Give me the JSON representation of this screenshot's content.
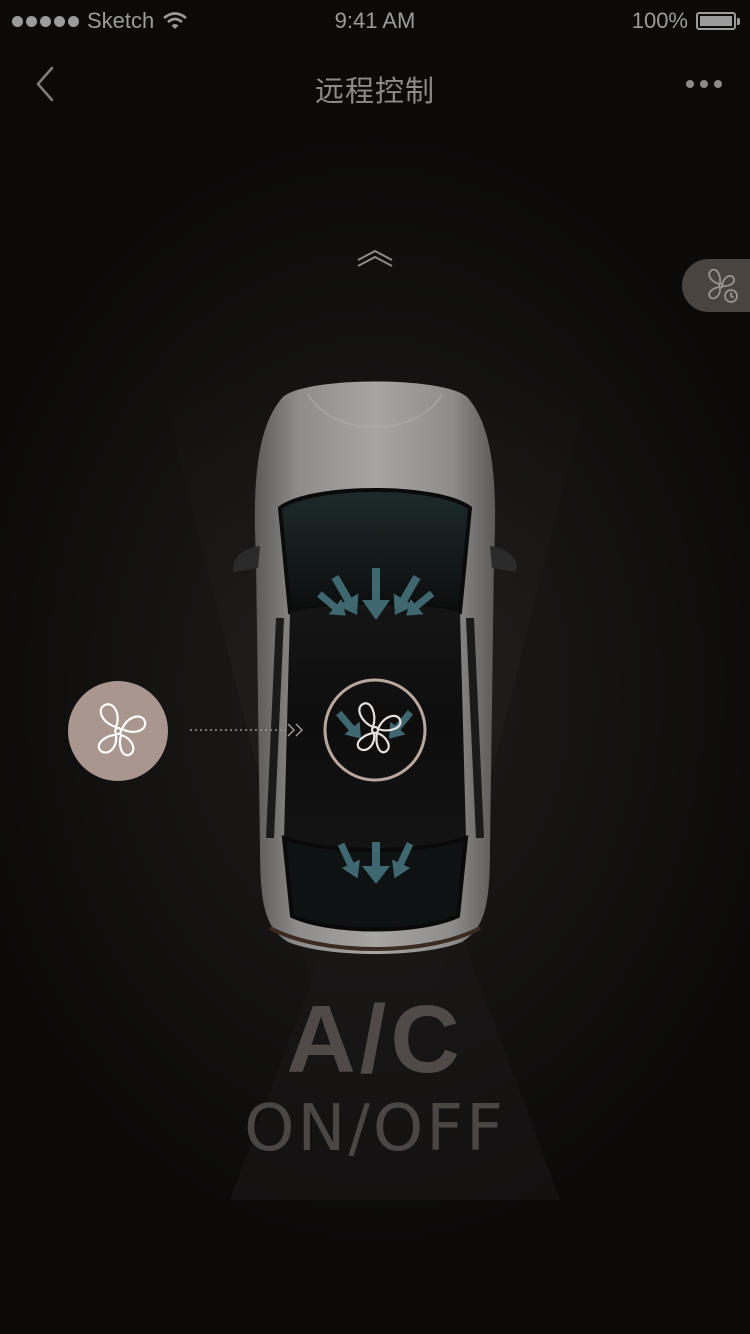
{
  "status_bar": {
    "carrier": "Sketch",
    "time": "9:41 AM",
    "battery": "100%",
    "battery_level": 1.0
  },
  "nav": {
    "title": "远程控制",
    "back_icon": "chevron-left-icon",
    "more_icon": "more-dots-icon"
  },
  "controls": {
    "expand_icon": "double-chevron-up-icon",
    "side_button_icon": "fan-timer-icon",
    "fan_button_icon": "fan-icon",
    "car_center_icon": "fan-icon"
  },
  "ac": {
    "label": "A/C",
    "state_label": "ON/OFF"
  },
  "colors": {
    "background": "#0b0a09",
    "accent": "#a9968e",
    "airflow": "#3f6770",
    "text_dim": "#4f4a47"
  }
}
